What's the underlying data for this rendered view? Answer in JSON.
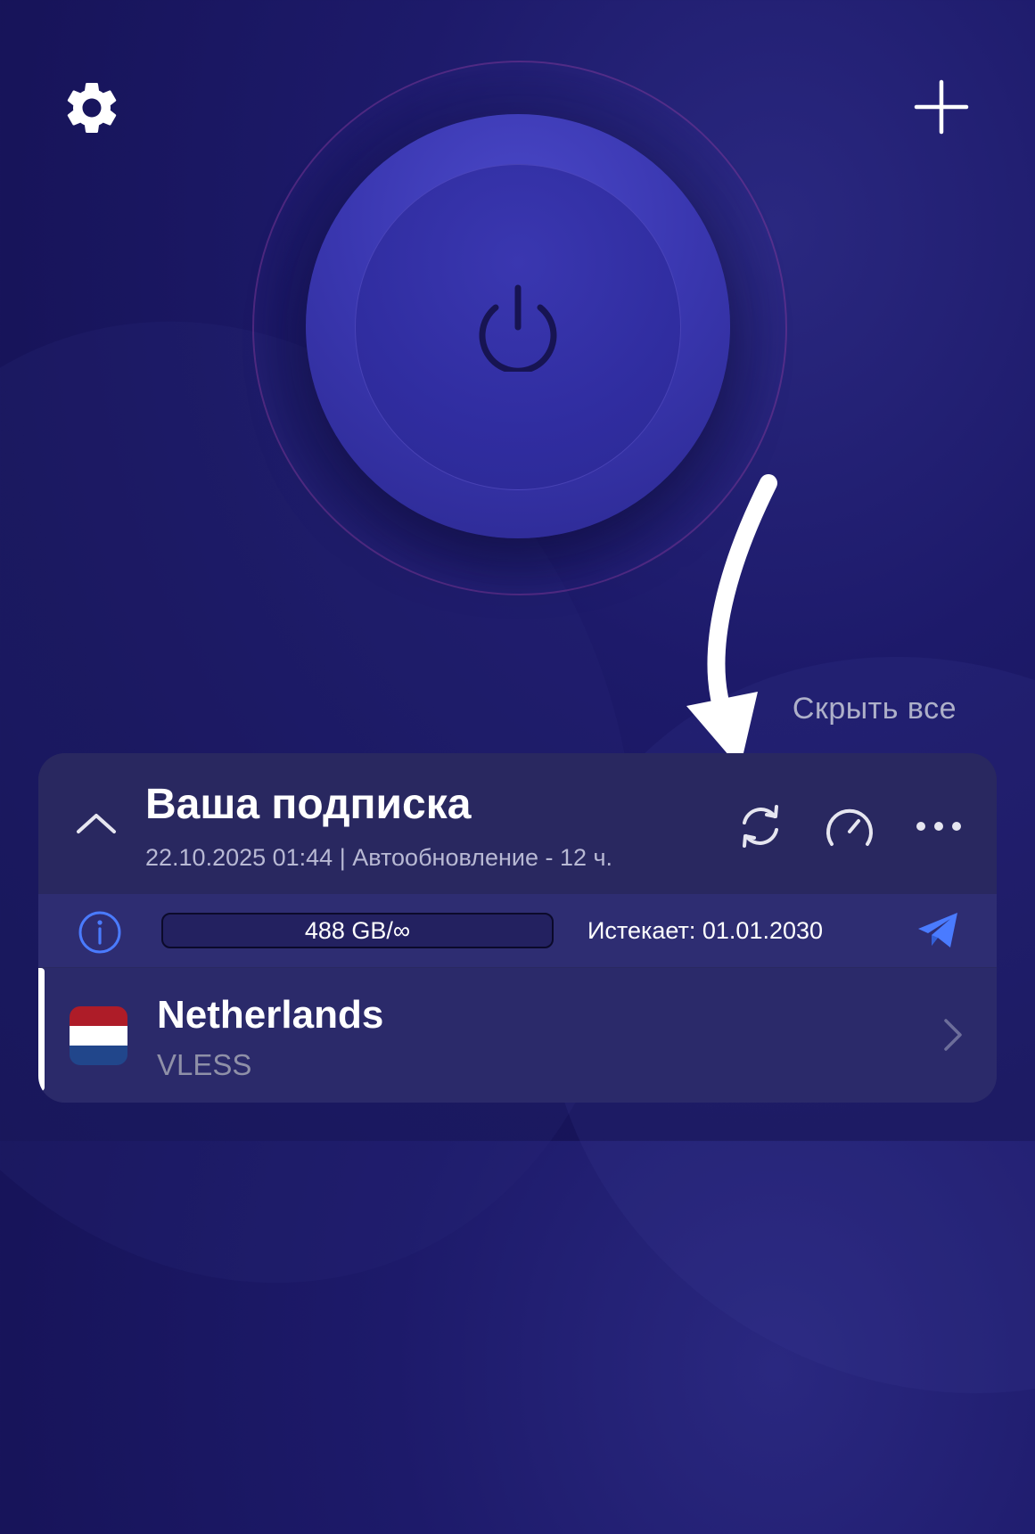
{
  "header": {
    "settings_icon": "gear-icon",
    "add_icon": "plus-icon"
  },
  "power_button": {
    "icon": "power-icon"
  },
  "hide_all_label": "Скрыть все",
  "subscription": {
    "title": "Ваша подписка",
    "meta": "22.10.2025 01:44 | Автообновление - 12 ч.",
    "traffic": "488 GB/∞",
    "expires": "Истекает: 01.01.2030",
    "actions": [
      "refresh-icon",
      "speedometer-icon",
      "more-icon",
      "telegram-icon"
    ]
  },
  "server": {
    "name": "Netherlands",
    "protocol": "VLESS",
    "flag_colors": [
      "#ae1c28",
      "#ffffff",
      "#21468b"
    ]
  },
  "colors": {
    "accent": "#4a7bff",
    "card_bg": "#2a2960",
    "info_row_bg": "#2e2d72"
  }
}
